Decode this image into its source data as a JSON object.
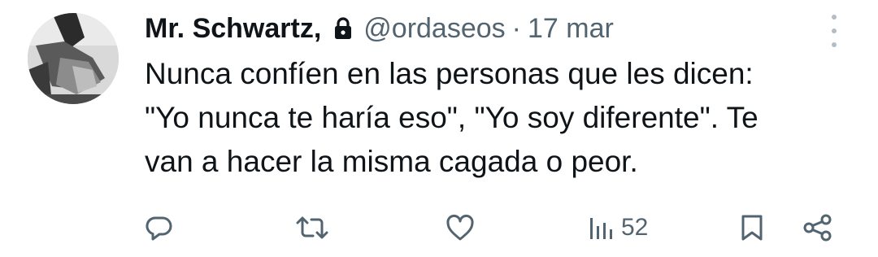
{
  "tweet": {
    "author_name": "Mr. Schwartz,",
    "handle": "@ordaseos",
    "separator": "·",
    "date": "17 mar",
    "text_lines": [
      "Nunca confíen en las personas que les dicen:",
      "\"Yo nunca te haría eso\", \"Yo soy diferente\". Te",
      "van a hacer la misma cagada o peor."
    ]
  },
  "actions": {
    "views_count": "52"
  },
  "icons": {
    "lock": "lock-icon",
    "more": "more-vertical-icon",
    "reply": "reply-icon",
    "retweet": "retweet-icon",
    "like": "heart-icon",
    "views": "views-bar-chart-icon",
    "bookmark": "bookmark-icon",
    "share": "share-icon"
  },
  "colors": {
    "text_primary": "#0f1419",
    "text_secondary": "#536471",
    "background": "#ffffff"
  }
}
